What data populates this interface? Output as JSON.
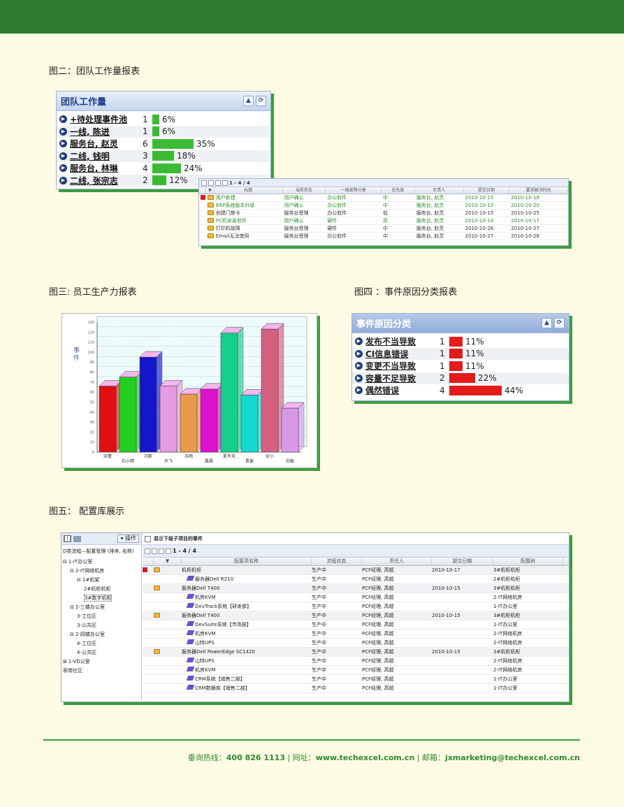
{
  "captions": {
    "fig2": "图二：团队工作量报表",
    "fig3": "图三: 员工生产力报表",
    "fig4": "图四 ：事件原因分类报表",
    "fig5": "图五： 配置库展示"
  },
  "workload": {
    "title": "团队工作量",
    "rows": [
      {
        "name": "+待处理事件池",
        "count": "1",
        "pct": "6%",
        "frac": 0.06
      },
      {
        "name": "一线, 陈进",
        "count": "1",
        "pct": "6%",
        "frac": 0.06
      },
      {
        "name": "服务台, 赵灵",
        "count": "6",
        "pct": "35%",
        "frac": 0.35
      },
      {
        "name": "二线, 钱明",
        "count": "3",
        "pct": "18%",
        "frac": 0.18
      },
      {
        "name": "服务台, 林琳",
        "count": "4",
        "pct": "24%",
        "frac": 0.24
      },
      {
        "name": "二线, 张宗志",
        "count": "2",
        "pct": "12%",
        "frac": 0.12
      }
    ]
  },
  "event_grid": {
    "pager": "1 - 4 / 4",
    "headers": [
      "",
      "",
      "标题",
      "当前状态",
      "一级故障分类",
      "优先级",
      "负责人",
      "提交日期",
      "要求解决时间"
    ],
    "rows": [
      {
        "title": "用户新建",
        "status": "用户确认",
        "cat": "办公软件",
        "pri": "中",
        "owner": "服务台, 赵灵",
        "date": "2010-10-15",
        "due": "2010-10-18",
        "green": true,
        "flag": true
      },
      {
        "title": "ERP系统版本升级",
        "status": "用户确认",
        "cat": "办公软件",
        "pri": "中",
        "owner": "服务台, 赵灵",
        "date": "2010-10-15",
        "due": "2010-10-20",
        "green": true,
        "flag": false
      },
      {
        "title": "创建门禁卡",
        "status": "服务台受理",
        "cat": "办公软件",
        "pri": "低",
        "owner": "服务台, 赵灵",
        "date": "2010-10-15",
        "due": "2010-10-25",
        "green": false,
        "flag": false
      },
      {
        "title": "PC机安装软件",
        "status": "用户确认",
        "cat": "硬件",
        "pri": "高",
        "owner": "服务台, 赵灵",
        "date": "2010-10-14",
        "due": "2010-10-17",
        "green": true,
        "flag": false
      },
      {
        "title": "打印机故障",
        "status": "服务台受理",
        "cat": "硬件",
        "pri": "中",
        "owner": "服务台, 赵灵",
        "date": "2010-10-26",
        "due": "2010-10-27",
        "green": false,
        "flag": false
      },
      {
        "title": "Email无法使用",
        "status": "服务台受理",
        "cat": "办公软件",
        "pri": "中",
        "owner": "服务台, 赵灵",
        "date": "2010-10-27",
        "due": "2010-10-28",
        "green": false,
        "flag": false
      }
    ]
  },
  "chart_data": {
    "type": "bar",
    "ylabel": "事件",
    "ylim": [
      0,
      130
    ],
    "yticks": [
      0,
      10,
      20,
      30,
      40,
      50,
      60,
      70,
      80,
      90,
      100,
      110,
      120,
      130
    ],
    "categories": [
      "宋蕾",
      "石小晴",
      "刘斯",
      "许飞",
      "苏雨",
      "晨晨",
      "夏冬天",
      "晋宴",
      "安小",
      "苏敏"
    ],
    "values": [
      66,
      75,
      95,
      66,
      58,
      63,
      119,
      57,
      123,
      44
    ],
    "colors": [
      "#e01010",
      "#22d022",
      "#1515cc",
      "#e59be0",
      "#e89a4d",
      "#dd11cc",
      "#15d08a",
      "#15d8d0",
      "#d56080",
      "#d898e8"
    ]
  },
  "cause": {
    "title": "事件原因分类",
    "rows": [
      {
        "name": "发布不当导致",
        "count": "1",
        "pct": "11%",
        "frac": 0.11
      },
      {
        "name": "CI信息错误",
        "count": "1",
        "pct": "11%",
        "frac": 0.11
      },
      {
        "name": "变更不当导致",
        "count": "1",
        "pct": "11%",
        "frac": 0.11
      },
      {
        "name": "容量不足导致",
        "count": "2",
        "pct": "22%",
        "frac": 0.22
      },
      {
        "name": "偶然错误",
        "count": "4",
        "pct": "44%",
        "frac": 0.44
      }
    ]
  },
  "config": {
    "op_button": "▾ 操作",
    "tree_title": "D类流程—配置管理 (排序, 名称)",
    "tree": [
      {
        "label": "1-IT办公室",
        "indent": 0,
        "exp": "⊟"
      },
      {
        "label": "2-IT网络机房",
        "indent": 1,
        "exp": "⊟"
      },
      {
        "label": "1#机架",
        "indent": 2,
        "exp": "⊟"
      },
      {
        "label": "2#机柜机柜",
        "indent": 3,
        "exp": ""
      },
      {
        "label": "3#数字机柜",
        "indent": 3,
        "exp": ""
      },
      {
        "label": "2-三楼办公室",
        "indent": 1,
        "exp": "⊟"
      },
      {
        "label": "3-工位区",
        "indent": 2,
        "exp": ""
      },
      {
        "label": "3-公共区",
        "indent": 2,
        "exp": ""
      },
      {
        "label": "2-四楼办公室",
        "indent": 1,
        "exp": "⊟"
      },
      {
        "label": "4-工位区",
        "indent": 2,
        "exp": ""
      },
      {
        "label": "4-公共区",
        "indent": 2,
        "exp": ""
      },
      {
        "label": "1-VD公室",
        "indent": 0,
        "exp": "⊞"
      },
      {
        "label": "客带社区",
        "indent": 0,
        "exp": ""
      }
    ],
    "show_sub": "显示下级子项目的事件",
    "pager": "1 - 4 / 4",
    "headers": [
      "",
      "配置项名称",
      "流程状态",
      "责任人",
      "提交日期",
      "配置树"
    ],
    "rows": [
      {
        "name": "机柜机柜",
        "state": "生产中",
        "owner": "PCF经理, 高超",
        "date": "2010-10-17",
        "loc": "3#机柜机柜",
        "lvl": 0,
        "icon": true,
        "flag": true
      },
      {
        "name": "服务器Dell R210",
        "state": "生产中",
        "owner": "PCF经理, 高超",
        "date": "",
        "loc": "2#机柜机柜",
        "lvl": 1,
        "icon": false,
        "flag": false
      },
      {
        "name": "服务器Dell T400",
        "state": "生产中",
        "owner": "PCF经理, 高超",
        "date": "2010-10-15",
        "loc": "3#机柜机柜",
        "lvl": 0,
        "icon": true,
        "flag": false
      },
      {
        "name": "机房KVM",
        "state": "生产中",
        "owner": "PCF经理, 高超",
        "date": "",
        "loc": "2-IT网络机房",
        "lvl": 1,
        "icon": false,
        "flag": false
      },
      {
        "name": "DevTrack系统【研发部】",
        "state": "生产中",
        "owner": "PCF经理, 高超",
        "date": "",
        "loc": "1-IT办公室",
        "lvl": 1,
        "icon": false,
        "flag": false
      },
      {
        "name": "服务器Dell T400",
        "state": "生产中",
        "owner": "PCF经理, 高超",
        "date": "2010-10-15",
        "loc": "3#机柜机柜",
        "lvl": 0,
        "icon": true,
        "flag": false
      },
      {
        "name": "DevSuite系统【市场部】",
        "state": "生产中",
        "owner": "PCF经理, 高超",
        "date": "",
        "loc": "1-IT办公室",
        "lvl": 1,
        "icon": false,
        "flag": false
      },
      {
        "name": "机房KVM",
        "state": "生产中",
        "owner": "PCF经理, 高超",
        "date": "",
        "loc": "2-IT网络机房",
        "lvl": 1,
        "icon": false,
        "flag": false
      },
      {
        "name": "山特UPS",
        "state": "生产中",
        "owner": "PCF经理, 高超",
        "date": "",
        "loc": "2-IT网络机房",
        "lvl": 1,
        "icon": false,
        "flag": false
      },
      {
        "name": "服务器Dell PowerEdge SC1420",
        "state": "生产中",
        "owner": "PCF经理, 高超",
        "date": "2010-10-15",
        "loc": "3#机柜机柜",
        "lvl": 0,
        "icon": true,
        "flag": false
      },
      {
        "name": "山特UPS",
        "state": "生产中",
        "owner": "PCF经理, 高超",
        "date": "",
        "loc": "2-IT网络机房",
        "lvl": 1,
        "icon": false,
        "flag": false
      },
      {
        "name": "机房KVM",
        "state": "生产中",
        "owner": "PCF经理, 高超",
        "date": "",
        "loc": "2-IT网络机房",
        "lvl": 1,
        "icon": false,
        "flag": false
      },
      {
        "name": "CRM系统【销售二部】",
        "state": "生产中",
        "owner": "PCF经理, 高超",
        "date": "",
        "loc": "1-IT办公室",
        "lvl": 1,
        "icon": false,
        "flag": false
      },
      {
        "name": "CRM数据库【销售二部】",
        "state": "生产中",
        "owner": "PCF经理, 高超",
        "date": "",
        "loc": "1-IT办公室",
        "lvl": 1,
        "icon": false,
        "flag": false
      }
    ]
  },
  "footer": {
    "hotline_label": "垂询热线：",
    "hotline": "400 826 1113",
    "web_label": "| 网址：",
    "web": "www.techexcel.com.cn",
    "mail_label": "| 邮箱：",
    "mail": "jxmarketing@techexcel.com.cn"
  }
}
